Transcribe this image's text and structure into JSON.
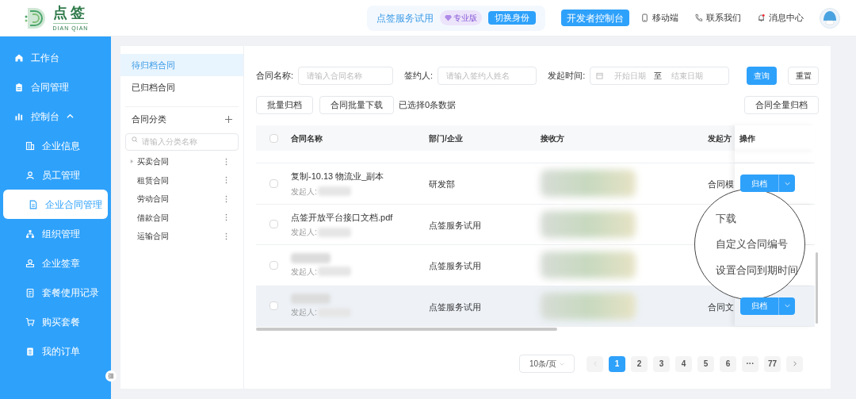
{
  "header": {
    "logo": {
      "title": "点签",
      "subtitle": "DIAN QIAN"
    },
    "account": "点签服务试用",
    "edition_badge": "专业版",
    "switch_button": "切换身份",
    "dev_button": "开发者控制台",
    "links": [
      {
        "label": "移动端",
        "kind": "mobile"
      },
      {
        "label": "联系我们",
        "kind": "phone"
      },
      {
        "label": "消息中心",
        "kind": "bell"
      }
    ]
  },
  "sidebar": {
    "items": [
      {
        "label": "工作台",
        "kind": "home",
        "selected": false
      },
      {
        "label": "合同管理",
        "kind": "clipboard",
        "selected": false
      },
      {
        "label": "控制台",
        "kind": "chart",
        "selected": false,
        "expanded": true,
        "children": [
          {
            "label": "企业信息",
            "kind": "building",
            "selected": false
          },
          {
            "label": "员工管理",
            "kind": "person",
            "selected": false
          },
          {
            "label": "企业合同管理",
            "kind": "file",
            "selected": true
          },
          {
            "label": "组织管理",
            "kind": "org",
            "selected": false
          },
          {
            "label": "企业签章",
            "kind": "stamp",
            "selected": false
          },
          {
            "label": "套餐使用记录",
            "kind": "doc",
            "selected": false
          },
          {
            "label": "购买套餐",
            "kind": "cart",
            "selected": false
          },
          {
            "label": "我的订单",
            "kind": "list",
            "selected": false
          }
        ]
      }
    ]
  },
  "category_panel": {
    "tabs": [
      {
        "label": "待归档合同",
        "selected": true
      },
      {
        "label": "已归档合同",
        "selected": false
      }
    ],
    "section_title": "合同分类",
    "search": {
      "placeholder": "请输入分类名称"
    },
    "categories": [
      {
        "label": "买卖合同",
        "has_children": true
      },
      {
        "label": "租赁合同",
        "has_children": false
      },
      {
        "label": "劳动合同",
        "has_children": false
      },
      {
        "label": "借款合同",
        "has_children": false
      },
      {
        "label": "运输合同",
        "has_children": false
      }
    ]
  },
  "filters": {
    "contract_name": {
      "label": "合同名称:",
      "placeholder": "请输入合同名称"
    },
    "signer": {
      "label": "签约人:",
      "placeholder": "请输入签约人姓名"
    },
    "date_range": {
      "label": "发起时间:",
      "start_placeholder": "开始日期",
      "separator": "至",
      "end_placeholder": "结束日期"
    },
    "query_button": "查询",
    "reset_button": "重置"
  },
  "actions": {
    "buttons": [
      "批量归档",
      "合同批量下载"
    ],
    "selection_info": "已选择0条数据",
    "archive_all_button": "合同全量归档"
  },
  "table": {
    "select_all_checked": false,
    "columns": [
      "合同名称",
      "部门/企业",
      "接收方",
      "发起方",
      "操作"
    ],
    "rows": [
      {
        "checked": false,
        "name": "复制-10.13 物流业_副本",
        "initiator_label": "发起人:",
        "department": "研发部",
        "initiator_type": "合同模",
        "action": "归档",
        "hovered": false
      },
      {
        "checked": false,
        "name": "点签开放平台接口文档.pdf",
        "initiator_label": "发起人:",
        "department": "点签服务试用",
        "hovered": false
      },
      {
        "checked": false,
        "initiator_label": "发起人:",
        "department": "点签服务试用",
        "hovered": false
      },
      {
        "checked": false,
        "initiator_label": "发起人:",
        "department": "点签服务试用",
        "initiator_type": "合同文",
        "action": "归档",
        "hovered": true
      }
    ]
  },
  "dropdown_menu": [
    "下载",
    "自定义合同编号",
    "设置合同到期时间"
  ],
  "pagination": {
    "page_size": "10条/页",
    "pages": [
      {
        "label": "1",
        "selected": true
      },
      {
        "label": "2",
        "selected": false
      },
      {
        "label": "3",
        "selected": false
      },
      {
        "label": "4",
        "selected": false
      },
      {
        "label": "5",
        "selected": false
      },
      {
        "label": "6",
        "selected": false
      },
      {
        "label": "···",
        "selected": false
      },
      {
        "label": "77",
        "selected": false
      }
    ]
  }
}
